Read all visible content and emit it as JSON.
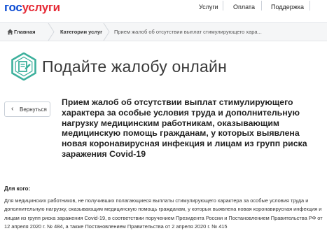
{
  "header": {
    "logo": {
      "part1": "гос",
      "part2": "услуги"
    },
    "nav": [
      {
        "label": "Услуги"
      },
      {
        "label": "Оплата"
      },
      {
        "label": "Поддержка"
      }
    ]
  },
  "breadcrumb": {
    "home": "Главная",
    "category": "Категории услуг",
    "current": "Прием жалоб об отсутствии выплат стимулирующего хара..."
  },
  "page": {
    "title": "Подайте жалобу онлайн"
  },
  "back_button": {
    "label": "Вернуться"
  },
  "service": {
    "title": "Прием жалоб об отсутствии выплат стимулирующего характера за особые условия труда и дополнительную нагрузку медицинским работникам, оказывающим медицинскую помощь гражданам, у которых выявлена новая коронавирусная инфекция и лицам из групп риска заражения Covid-19",
    "for_whom_label": "Для кого:",
    "description": "Для медицинских работников, не получивших полагающиеся выплаты стимулирующего характера за особые условия труда и дополнительную нагрузку, оказывающим медицинскую помощь гражданам, у которых выявлена новая коронавирусная инфекция и лицам из групп риска заражения Covid-19, в соответствии поручением Президента России и Постановлением Правительства РФ от 12 апреля 2020 г. № 484, а также Постановлением Правительства от 2 апреля 2020 г. № 415"
  },
  "colors": {
    "brand_blue": "#0d4cd3",
    "brand_red": "#e62d39",
    "icon_teal": "#3cb09c"
  }
}
